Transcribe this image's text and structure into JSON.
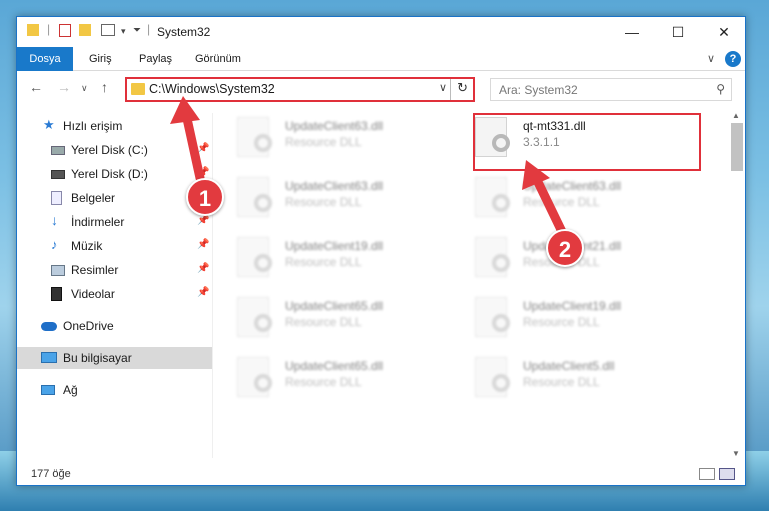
{
  "window": {
    "title": "System32",
    "accent": "#1979ca",
    "highlight_color": "#e0303a"
  },
  "ribbon": {
    "tabs": [
      "Dosya",
      "Giriş",
      "Paylaş",
      "Görünüm"
    ],
    "help_label": "?"
  },
  "address": {
    "path": "C:\\Windows\\System32",
    "search_placeholder": "Ara: System32"
  },
  "nav": {
    "items": [
      {
        "label": "Hızlı erişim",
        "icon": "star-icon"
      },
      {
        "label": "Yerel Disk (C:)",
        "icon": "drive-icon"
      },
      {
        "label": "Yerel Disk (D:)",
        "icon": "drive-icon"
      },
      {
        "label": "Belgeler",
        "icon": "documents-icon"
      },
      {
        "label": "İndirmeler",
        "icon": "download-icon"
      },
      {
        "label": "Müzik",
        "icon": "music-icon"
      },
      {
        "label": "Resimler",
        "icon": "pictures-icon"
      },
      {
        "label": "Videolar",
        "icon": "video-icon"
      },
      {
        "label": "OneDrive",
        "icon": "cloud-icon"
      },
      {
        "label": "Bu bilgisayar",
        "icon": "computer-icon"
      },
      {
        "label": "Ağ",
        "icon": "network-icon"
      }
    ]
  },
  "files": [
    {
      "name": "UpdateClient63.dll",
      "desc": "Resource DLL"
    },
    {
      "name": "qt-mt331.dll",
      "desc": "3.3.1.1"
    },
    {
      "name": "UpdateClient63.dll",
      "desc": "Resource DLL"
    },
    {
      "name": "UpdateClient63.dll",
      "desc": "Resource DLL"
    },
    {
      "name": "UpdateClient19.dll",
      "desc": "Resource DLL"
    },
    {
      "name": "UpdateClient21.dll",
      "desc": "Resource DLL"
    },
    {
      "name": "UpdateClient65.dll",
      "desc": "Resource DLL"
    },
    {
      "name": "UpdateClient19.dll",
      "desc": "Resource DLL"
    },
    {
      "name": "UpdateClient65.dll",
      "desc": "Resource DLL"
    },
    {
      "name": "UpdateClient5.dll",
      "desc": "Resource DLL"
    }
  ],
  "status": {
    "count": "177 öğe"
  },
  "callouts": [
    "1",
    "2"
  ]
}
